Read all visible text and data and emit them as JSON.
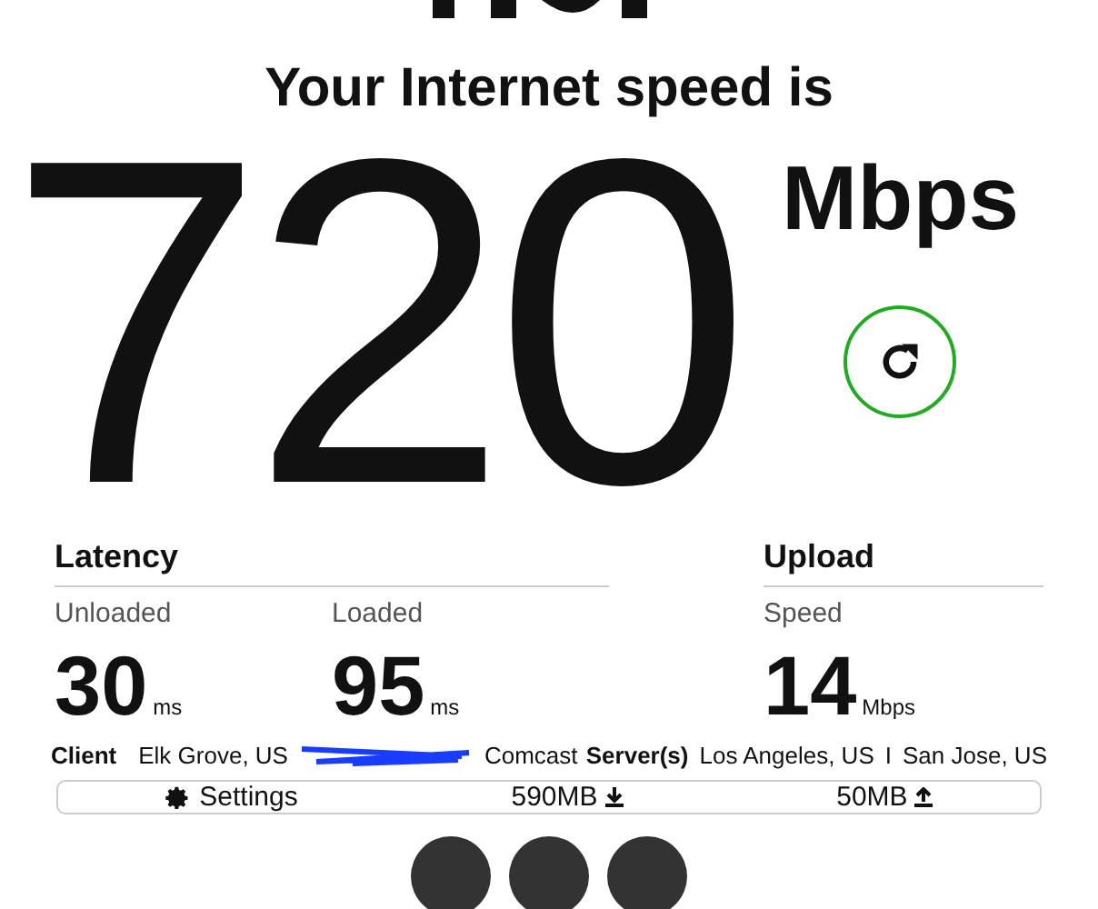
{
  "headline": "Your Internet speed is",
  "speed": {
    "value": "720",
    "unit": "Mbps"
  },
  "latency": {
    "title": "Latency",
    "items": [
      {
        "label": "Unloaded",
        "value": "30",
        "unit": "ms"
      },
      {
        "label": "Loaded",
        "value": "95",
        "unit": "ms"
      }
    ]
  },
  "upload": {
    "title": "Upload",
    "items": [
      {
        "label": "Speed",
        "value": "14",
        "unit": "Mbps"
      }
    ]
  },
  "client": {
    "label": "Client",
    "location": "Elk Grove, US",
    "isp": "Comcast"
  },
  "servers": {
    "label": "Server(s)",
    "list": [
      "Los Angeles, US",
      "San Jose, US"
    ],
    "separator": "I"
  },
  "settings_bar": {
    "settings": "Settings",
    "download": "590MB",
    "upload": "50MB"
  }
}
